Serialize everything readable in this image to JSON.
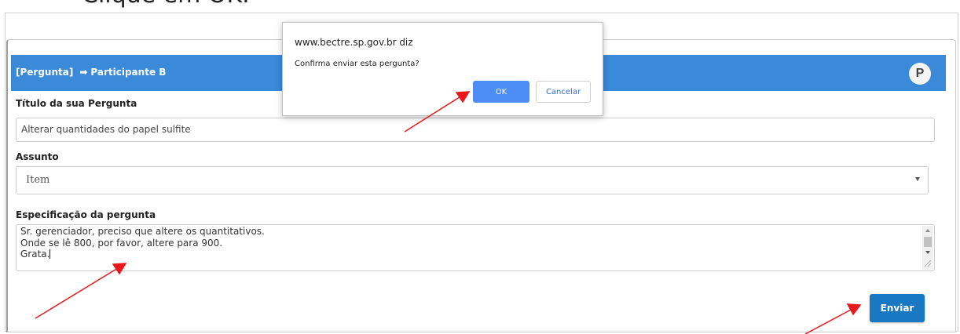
{
  "instruction": "Clique em OK.",
  "form": {
    "header_tag": "[Pergunta]",
    "header_arrow": "➡",
    "header_participant": "Participante B",
    "avatar_letter": "P",
    "title_label": "Título da sua Pergunta",
    "title_value": "Alterar quantidades do papel sulfite",
    "subject_label": "Assunto",
    "subject_value": "Item",
    "spec_label": "Especificação da pergunta",
    "spec_lines": [
      "Sr. gerenciador, preciso que altere os quantitativos.",
      "Onde se lê 800, por favor, altere para 900.",
      "Grata."
    ],
    "send_label": "Enviar"
  },
  "dialog": {
    "origin": "www.bectre.sp.gov.br diz",
    "message": "Confirma enviar esta pergunta?",
    "ok_label": "OK",
    "cancel_label": "Cancelar"
  },
  "colors": {
    "header_bar": "#3a8ad9",
    "send_button": "#1a78c2",
    "ok_button": "#4e8df5",
    "annotation_arrow": "#e8191c"
  },
  "icons": {
    "header_arrow": "right-arrow-icon",
    "select_caret": "chevron-down-icon"
  }
}
